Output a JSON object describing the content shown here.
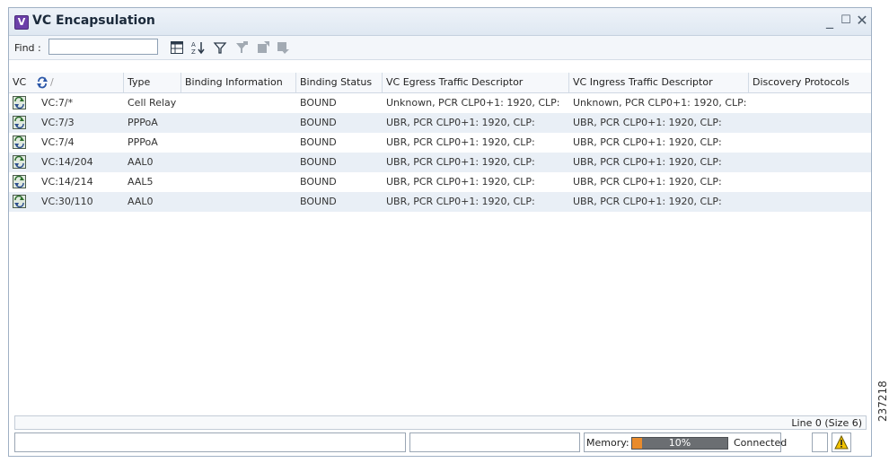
{
  "window": {
    "title": "VC Encapsulation",
    "app_icon_letter": "V",
    "minimize": "_",
    "maximize": "☐",
    "close": "✕"
  },
  "toolbar": {
    "find_label": "Find :",
    "find_value": "",
    "icons": [
      "table-settings-icon",
      "sort-az-icon",
      "filter-icon",
      "advanced-filter-icon",
      "export-icon",
      "print-icon"
    ]
  },
  "table": {
    "columns": [
      "VC",
      "Type",
      "Binding Information",
      "Binding Status",
      "VC Egress Traffic Descriptor",
      "VC Ingress Traffic Descriptor",
      "Discovery Protocols"
    ],
    "rows": [
      {
        "vc": "VC:7/*",
        "type": "Cell Relay",
        "binding_info": "",
        "binding_status": "BOUND",
        "egress": "Unknown, PCR CLP0+1: 1920, CLP:",
        "ingress": "Unknown, PCR CLP0+1: 1920, CLP:",
        "discovery": ""
      },
      {
        "vc": "VC:7/3",
        "type": "PPPoA",
        "binding_info": "",
        "binding_status": "BOUND",
        "egress": "UBR, PCR CLP0+1: 1920, CLP:",
        "ingress": "UBR, PCR CLP0+1: 1920, CLP:",
        "discovery": ""
      },
      {
        "vc": "VC:7/4",
        "type": "PPPoA",
        "binding_info": "",
        "binding_status": "BOUND",
        "egress": "UBR, PCR CLP0+1: 1920, CLP:",
        "ingress": "UBR, PCR CLP0+1: 1920, CLP:",
        "discovery": ""
      },
      {
        "vc": "VC:14/204",
        "type": "AAL0",
        "binding_info": "",
        "binding_status": "BOUND",
        "egress": "UBR, PCR CLP0+1: 1920, CLP:",
        "ingress": "UBR, PCR CLP0+1: 1920, CLP:",
        "discovery": ""
      },
      {
        "vc": "VC:14/214",
        "type": "AAL5",
        "binding_info": "",
        "binding_status": "BOUND",
        "egress": "UBR, PCR CLP0+1: 1920, CLP:",
        "ingress": "UBR, PCR CLP0+1: 1920, CLP:",
        "discovery": ""
      },
      {
        "vc": "VC:30/110",
        "type": "AAL0",
        "binding_info": "",
        "binding_status": "BOUND",
        "egress": "UBR, PCR CLP0+1: 1920, CLP:",
        "ingress": "UBR, PCR CLP0+1: 1920, CLP:",
        "discovery": ""
      }
    ]
  },
  "footer": {
    "line_info": "Line 0 (Size 6)"
  },
  "statusbar": {
    "memory_label": "Memory:",
    "memory_percent": 10,
    "memory_text": "10%",
    "connection": "Connected"
  },
  "side_label": "237218",
  "colors": {
    "alt_row": "#e9eff6",
    "memory_fill": "#e98b2c",
    "warning": "#f2c200"
  }
}
